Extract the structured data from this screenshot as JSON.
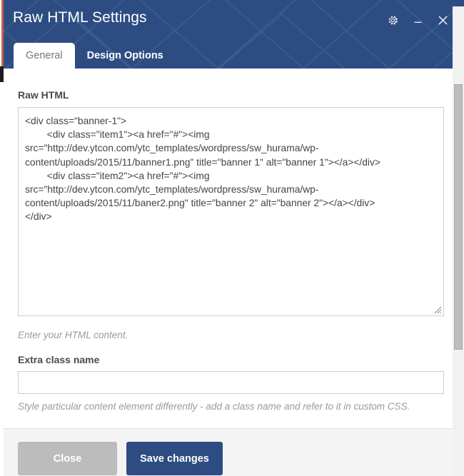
{
  "window": {
    "title": "Raw HTML Settings",
    "controls": [
      {
        "name": "settings-gear",
        "icon": "gear-icon",
        "label": "Settings"
      },
      {
        "name": "minimize",
        "icon": "minimize-icon",
        "label": "Minimize"
      },
      {
        "name": "close",
        "icon": "close-icon",
        "label": "Close"
      }
    ]
  },
  "tabs": [
    {
      "label": "General",
      "active": true
    },
    {
      "label": "Design Options",
      "active": false
    }
  ],
  "fields": {
    "raw_html": {
      "label": "Raw HTML",
      "help": "Enter your HTML content.",
      "value": "<div class=\"banner-1\">\n        <div class=\"item1\"><a href=\"#\"><img src=\"http://dev.ytcon.com/ytc_templates/wordpress/sw_hurama/wp-content/uploads/2015/11/banner1.png\" title=\"banner 1\" alt=\"banner 1\"></a></div>\n        <div class=\"item2\"><a href=\"#\"><img src=\"http://dev.ytcon.com/ytc_templates/wordpress/sw_hurama/wp-content/uploads/2015/11/baner2.png\" title=\"banner 2\" alt=\"banner 2\"></a></div>\n</div>",
      "placeholder": ""
    },
    "extra_class": {
      "label": "Extra class name",
      "help": "Style particular content element differently - add a class name and refer to it in custom CSS.",
      "value": "",
      "placeholder": ""
    }
  },
  "footer": {
    "close_label": "Close",
    "save_label": "Save changes"
  },
  "colors": {
    "header_blue": "#2d4d82",
    "primary_button": "#2d4d82",
    "secondary_button": "#bcbcbc",
    "footer_background": "#f4f4f4",
    "help_text": "#9a9a9a",
    "label_text": "#4a4a4a",
    "accent_edge": "#c2654a"
  }
}
